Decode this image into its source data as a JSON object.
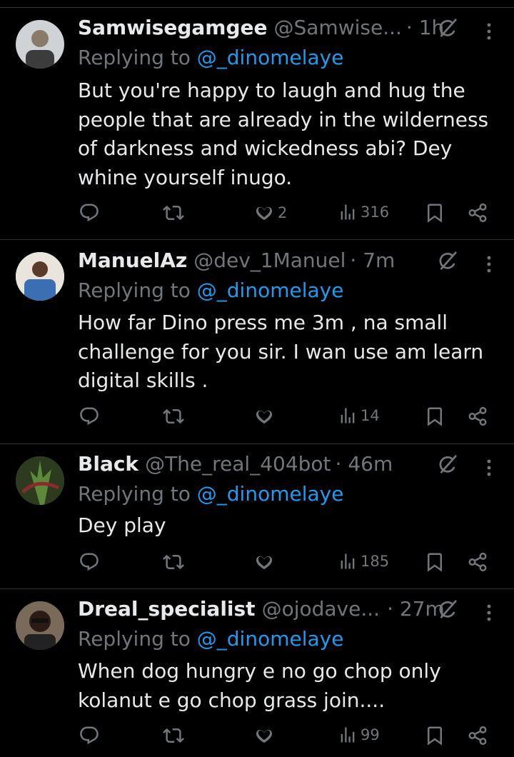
{
  "tweets": [
    {
      "name": "Samwisegamgee",
      "handle": "@Samwise...",
      "time": "· 1h",
      "reply_prefix": "Replying to",
      "reply_mention": "@_dinomelaye",
      "text": "But you're happy to laugh and hug the people that are already in the wilderness of darkness and wickedness abi? Dey whine yourself inugo.",
      "likes": "2",
      "views": "316",
      "avatar_color": "#cfd3d6"
    },
    {
      "name": "ManuelAz",
      "handle": "@dev_1Manuel",
      "time": "· 7m",
      "reply_prefix": "Replying to",
      "reply_mention": "@_dinomelaye",
      "text": "How far Dino press me 3m , na small challenge for you sir. I wan use am learn digital skills .",
      "likes": "",
      "views": "14",
      "avatar_color": "#3a6fb4"
    },
    {
      "name": "Black",
      "handle": "@The_real_404bot",
      "time": "· 46m",
      "reply_prefix": "Replying to",
      "reply_mention": "@_dinomelaye",
      "text": "Dey play",
      "likes": "",
      "views": "185",
      "avatar_color": "#3f5a2a"
    },
    {
      "name": "Dreal_specialist",
      "handle": "@ojodave...",
      "time": "· 27m",
      "reply_prefix": "Replying to",
      "reply_mention": "@_dinomelaye",
      "text": "When dog hungry e no go chop only kolanut e go chop grass join....",
      "likes": "",
      "views": "99",
      "avatar_color": "#5a4a3c"
    }
  ],
  "colors": {
    "background": "#000000",
    "text": "#e7e9ea",
    "secondary": "#71767b",
    "accent": "#1d9bf0",
    "divider": "#2f3336"
  },
  "icons": [
    "grok-icon",
    "more-icon",
    "reply-icon",
    "retweet-icon",
    "like-icon",
    "views-icon",
    "bookmark-icon",
    "share-icon"
  ]
}
